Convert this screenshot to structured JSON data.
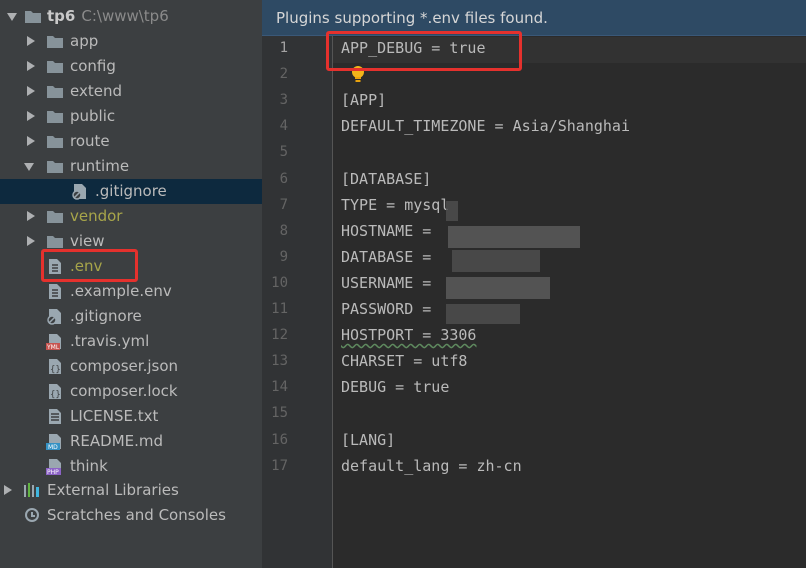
{
  "project": {
    "root_name": "tp6",
    "root_path": "C:\\www\\tp6",
    "items": [
      {
        "label": "app",
        "kind": "folder",
        "color": "#bbbbbb"
      },
      {
        "label": "config",
        "kind": "folder",
        "color": "#bbbbbb"
      },
      {
        "label": "extend",
        "kind": "folder",
        "color": "#bbbbbb"
      },
      {
        "label": "public",
        "kind": "folder",
        "color": "#bbbbbb"
      },
      {
        "label": "route",
        "kind": "folder",
        "color": "#bbbbbb"
      },
      {
        "label": "runtime",
        "kind": "folder-open",
        "color": "#bbbbbb"
      },
      {
        "label": ".gitignore",
        "kind": "file-ignore",
        "color": "#bbbbbb"
      },
      {
        "label": "vendor",
        "kind": "folder",
        "color": "#a7a54a"
      },
      {
        "label": "view",
        "kind": "folder",
        "color": "#bbbbbb"
      },
      {
        "label": ".env",
        "kind": "file",
        "color": "#a7a54a"
      },
      {
        "label": ".example.env",
        "kind": "file",
        "color": "#bbbbbb"
      },
      {
        "label": ".gitignore",
        "kind": "file-ignore",
        "color": "#bbbbbb"
      },
      {
        "label": ".travis.yml",
        "kind": "yml",
        "color": "#bbbbbb"
      },
      {
        "label": "composer.json",
        "kind": "json",
        "color": "#bbbbbb"
      },
      {
        "label": "composer.lock",
        "kind": "json",
        "color": "#bbbbbb"
      },
      {
        "label": "LICENSE.txt",
        "kind": "text",
        "color": "#bbbbbb"
      },
      {
        "label": "README.md",
        "kind": "md",
        "color": "#bbbbbb"
      },
      {
        "label": "think",
        "kind": "php",
        "color": "#bbbbbb"
      }
    ],
    "external_libraries": "External Libraries",
    "scratches": "Scratches and Consoles"
  },
  "editor": {
    "banner": "Plugins supporting *.env files found.",
    "lines": [
      "APP_DEBUG = true",
      "",
      "[APP]",
      "DEFAULT_TIMEZONE = Asia/Shanghai",
      "",
      "[DATABASE]",
      "TYPE = mysql",
      "HOSTNAME = ",
      "DATABASE = ",
      "USERNAME = ",
      "PASSWORD = ",
      "HOSTPORT = 3306",
      "CHARSET = utf8",
      "DEBUG = true",
      "",
      "[LANG]",
      "default_lang = zh-cn"
    ]
  },
  "colors": {
    "tree_bg": "#3c3f41",
    "editor_bg": "#2b2b2b",
    "selection": "#0d293e",
    "highlight_box": "#e5312d",
    "banner_bg": "#2e4a64"
  }
}
